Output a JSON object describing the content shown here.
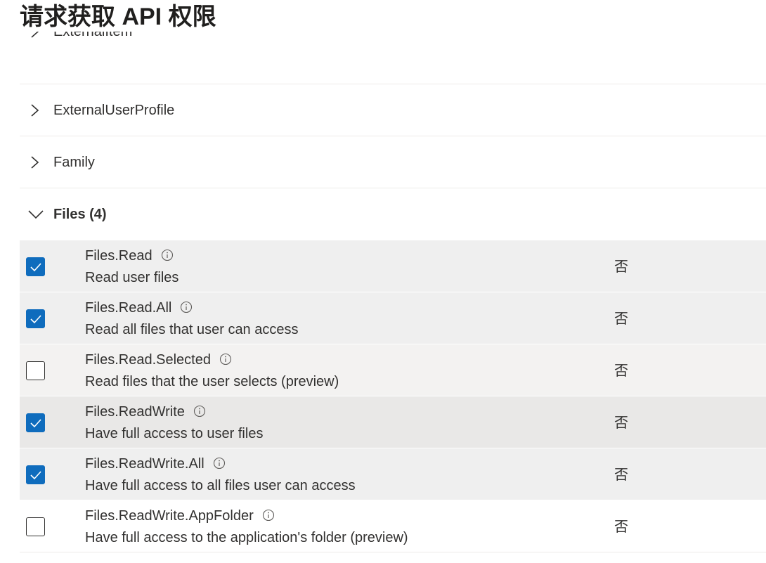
{
  "page_title": "请求获取 API 权限",
  "groups": [
    {
      "label": "ExternalItem"
    },
    {
      "label": "ExternalUserProfile"
    },
    {
      "label": "Family"
    },
    {
      "label": "Files (4)"
    }
  ],
  "permissions": [
    {
      "name": "Files.Read",
      "description": "Read user files",
      "admin_consent": "否",
      "checked": true
    },
    {
      "name": "Files.Read.All",
      "description": "Read all files that user can access",
      "admin_consent": "否",
      "checked": true
    },
    {
      "name": "Files.Read.Selected",
      "description": "Read files that the user selects (preview)",
      "admin_consent": "否",
      "checked": false
    },
    {
      "name": "Files.ReadWrite",
      "description": "Have full access to user files",
      "admin_consent": "否",
      "checked": true
    },
    {
      "name": "Files.ReadWrite.All",
      "description": "Have full access to all files user can access",
      "admin_consent": "否",
      "checked": true
    },
    {
      "name": "Files.ReadWrite.AppFolder",
      "description": "Have full access to the application's folder (preview)",
      "admin_consent": "否",
      "checked": false
    }
  ],
  "icons": {
    "collapsed": "chevron-right-icon",
    "expanded": "chevron-down-icon",
    "info": "info-icon",
    "check": "checkmark-icon"
  },
  "colors": {
    "checkbox_accent": "#0f6cbd",
    "row_shade": "#efefef",
    "text": "#323130"
  }
}
